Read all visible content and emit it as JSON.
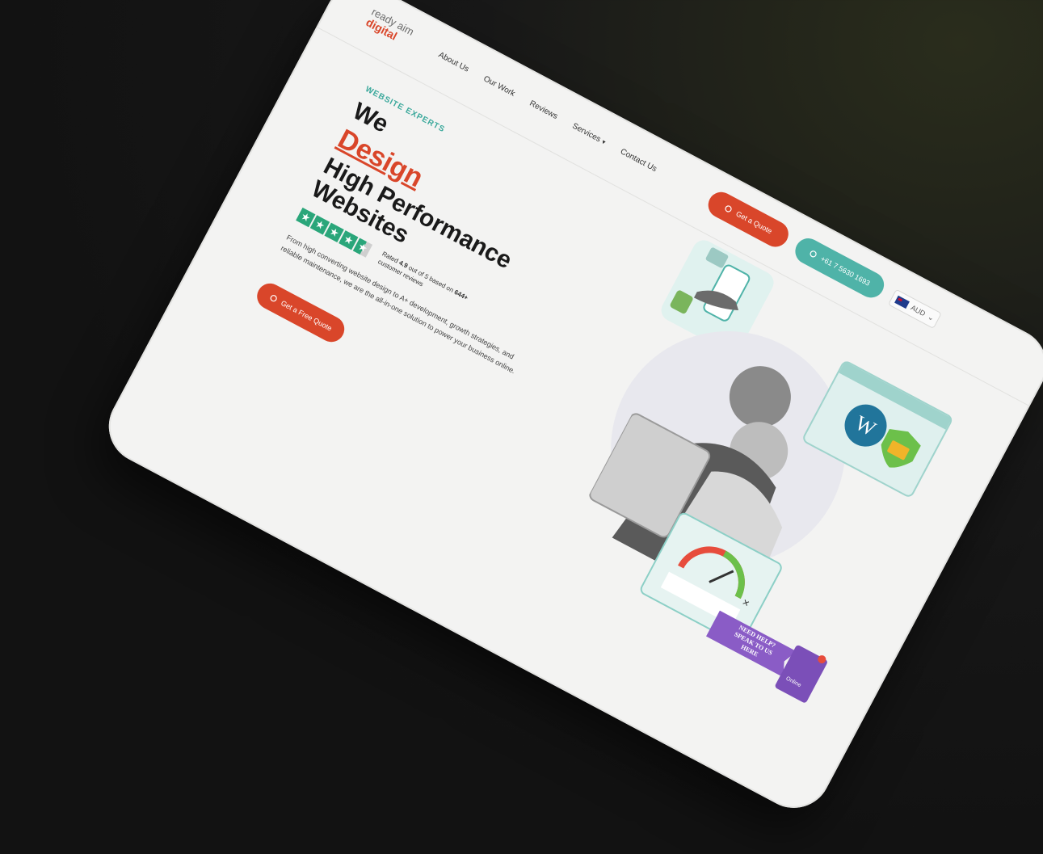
{
  "brand": {
    "line1": "ready aim",
    "line2": "digital"
  },
  "nav": {
    "items": [
      "About Us",
      "Our Work",
      "Reviews",
      "Services",
      "Contact Us"
    ],
    "services_caret": "▾"
  },
  "header": {
    "quote_button": "Get a Quote",
    "phone_button": "+61 7 5630 1693",
    "language": "AUD"
  },
  "hero": {
    "eyebrow": "WEBSITE EXPERTS",
    "line_we": "We",
    "line_design": "Design",
    "line_rest": "High Performance Websites",
    "rating_prefix": "Rated",
    "rating_value": "4.9",
    "rating_mid": "out of 5 based on",
    "rating_count": "644+",
    "rating_suffix": "customer reviews",
    "rating_stars": 4.5,
    "description": "From high converting website design to A+ development, growth strategies, and reliable maintenance, we are the all-in-one solution to power your business online.",
    "cta": "Get a Free Quote"
  },
  "helper_badge": {
    "line1": "NEED HELP?",
    "line2": "SPEAK TO US",
    "line3": "HERE",
    "status": "Online",
    "close": "×"
  },
  "icons": {
    "quote": "chat-icon",
    "phone": "phone-icon",
    "cta": "chat-icon"
  },
  "colors": {
    "brand_orange": "#d9462a",
    "brand_teal": "#4fb3a8",
    "trustpilot_green": "#2aa67a",
    "wordpress_blue": "#21759b",
    "helper_purple": "#8a5cc6"
  }
}
